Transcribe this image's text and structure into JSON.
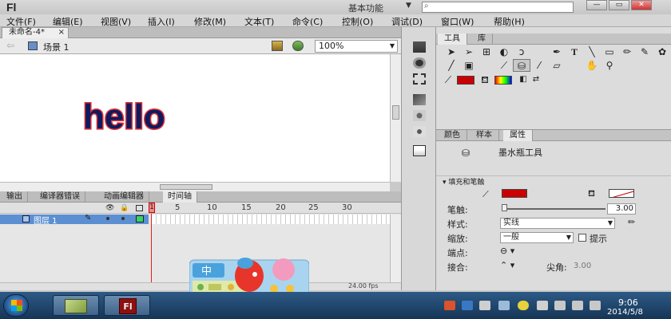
{
  "app": {
    "logo": "Fl",
    "workspace": "基本功能",
    "search_placeholder": ""
  },
  "window_buttons": [
    "—",
    "▭",
    "✕"
  ],
  "menu": [
    "文件(F)",
    "编辑(E)",
    "视图(V)",
    "插入(I)",
    "修改(M)",
    "文本(T)",
    "命令(C)",
    "控制(O)",
    "调试(D)",
    "窗口(W)",
    "帮助(H)"
  ],
  "document": {
    "tab_label": "未命名-4*",
    "tab_close": "×"
  },
  "scene": {
    "label": "场景 1",
    "zoom": "100%"
  },
  "stage": {
    "text": "hello",
    "text_color": "#0d1b5e",
    "selection_color": "#e0333a"
  },
  "bottom_tabs": [
    "输出",
    "编译器错误",
    "动画编辑器",
    "时间轴"
  ],
  "timeline": {
    "frame_numbers": [
      "1",
      "5",
      "10",
      "15",
      "20",
      "25",
      "30"
    ],
    "current_frame": "1",
    "layer_name": "图层 1",
    "fps": "24.00 fps"
  },
  "tools_tabs": [
    "工具",
    "库"
  ],
  "props_tabs": [
    "颜色",
    "样本",
    "属性"
  ],
  "props": {
    "tool_name": "墨水瓶工具",
    "section_fill_stroke": "填充和笔触",
    "stroke_label": "笔触:",
    "stroke_value": "3.00",
    "style_label": "样式:",
    "style_value": "实线",
    "scale_label": "缩放:",
    "scale_value": "一般",
    "hint_label": "提示",
    "cap_label": "端点:",
    "join_label": "接合:",
    "miter_label": "尖角:",
    "miter_value": "3.00",
    "stroke_color": "#cc0000"
  },
  "taskbar": {
    "time": "9:06",
    "date": "2014/5/8"
  },
  "mascot": {
    "badge_text": "中"
  }
}
